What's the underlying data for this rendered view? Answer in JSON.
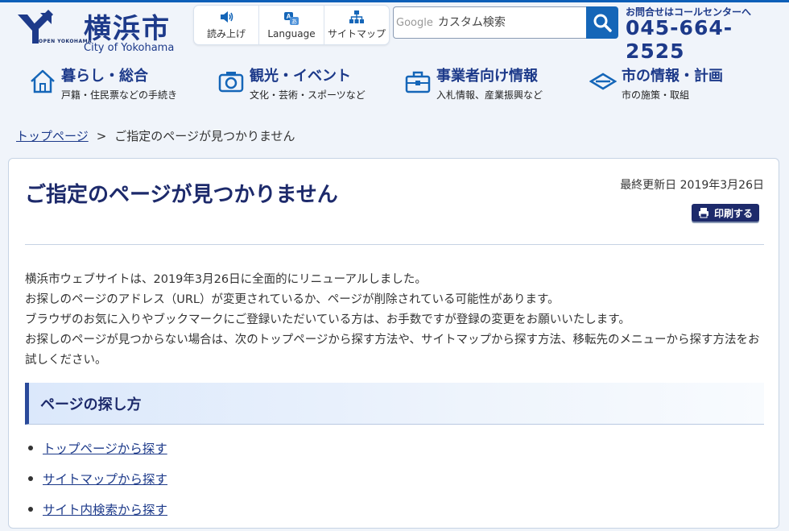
{
  "header": {
    "logo_small": "OPEN YOKOHAMA",
    "logo_title": "横浜市",
    "logo_sub": "City of Yokohama",
    "utilities": [
      {
        "label": "読み上げ",
        "icon": "speaker-icon"
      },
      {
        "label": "Language",
        "icon": "translate-icon"
      },
      {
        "label": "サイトマップ",
        "icon": "sitemap-icon"
      }
    ],
    "search": {
      "brand": "Google",
      "placeholder": "カスタム検索"
    },
    "contact": {
      "label": "お問合せはコールセンターへ",
      "phone": "045-664-2525"
    }
  },
  "gnav": [
    {
      "title": "暮らし・総合",
      "desc": "戸籍・住民票などの手続き",
      "icon": "house-icon"
    },
    {
      "title": "観光・イベント",
      "desc": "文化・芸術・スポーツなど",
      "icon": "camera-icon"
    },
    {
      "title": "事業者向け情報",
      "desc": "入札情報、産業振興など",
      "icon": "toolbox-icon"
    },
    {
      "title": "市の情報・計画",
      "desc": "市の施策・取組",
      "icon": "city-emblem-icon"
    }
  ],
  "breadcrumb": {
    "home": "トップページ",
    "separator": ">",
    "current": "ご指定のページが見つかりません"
  },
  "main": {
    "title": "ご指定のページが見つかりません",
    "updated": "最終更新日 2019年3月26日",
    "print_label": "印刷する",
    "paragraphs": [
      "横浜市ウェブサイトは、2019年3月26日に全面的にリニューアルしました。",
      "お探しのページのアドレス（URL）が変更されているか、ページが削除されている可能性があります。",
      "ブラウザのお気に入りやブックマークにご登録いただいている方は、お手数ですが登録の変更をお願いいたします。",
      "お探しのページが見つからない場合は、次のトップページから探す方法や、サイトマップから探す方法、移転先のメニューから探す方法をお試しください。"
    ],
    "section_heading": "ページの探し方",
    "links": [
      "トップページから探す",
      "サイトマップから探す",
      "サイト内検索から探す"
    ]
  },
  "colors": {
    "brand_navy": "#1d2a6b",
    "link_blue": "#1d3a8a",
    "accent_blue": "#1566b8"
  }
}
